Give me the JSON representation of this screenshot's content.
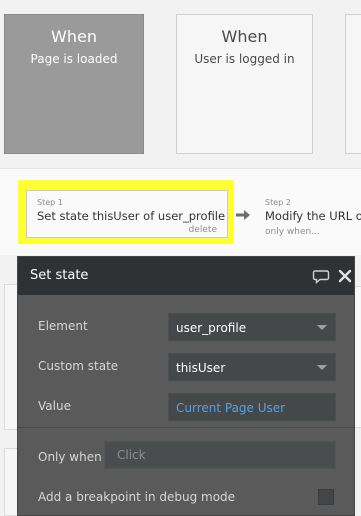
{
  "events": {
    "page_loaded": {
      "title": "When",
      "subtitle": "Page is loaded"
    },
    "user_logged_in": {
      "title": "When",
      "subtitle": "User is logged in"
    }
  },
  "steps": {
    "step1": {
      "number": "Step 1",
      "text": "Set state thisUser of user_profile",
      "delete_label": "delete"
    },
    "step2": {
      "number": "Step 2",
      "text": "Modify the URL o",
      "condition": "only when..."
    }
  },
  "dialog": {
    "title": "Set state",
    "element": {
      "label": "Element",
      "value": "user_profile"
    },
    "custom_state": {
      "label": "Custom state",
      "value": "thisUser"
    },
    "value": {
      "label": "Value",
      "value": "Current Page User"
    },
    "only_when": {
      "label": "Only when",
      "placeholder": "Click"
    },
    "breakpoint": {
      "label": "Add a breakpoint in debug mode"
    }
  },
  "colors": {
    "highlight": "#ffff33",
    "dialog_bg": "#5a5a5a",
    "dialog_header": "#2f3233",
    "dynamic_value": "#56a0e3"
  },
  "icons": {
    "arrow": "arrow-right-icon",
    "comment": "comment-icon",
    "close": "close-icon"
  }
}
